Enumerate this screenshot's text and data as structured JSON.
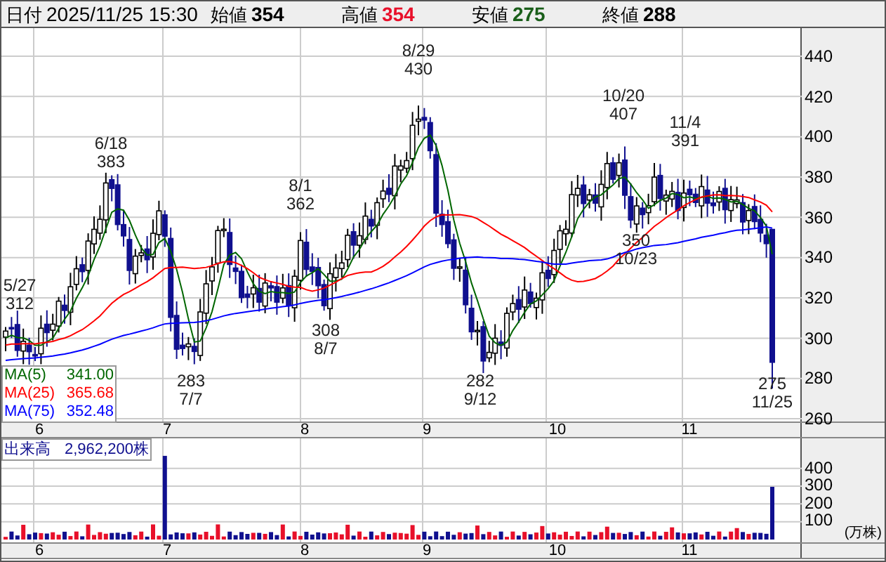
{
  "header": {
    "date_label": "日付",
    "date": "2025/11/25 15:30",
    "fields": [
      {
        "label": "始値",
        "value": "354",
        "kind": "open"
      },
      {
        "label": "高値",
        "value": "354",
        "kind": "high"
      },
      {
        "label": "安値",
        "value": "275",
        "kind": "low"
      },
      {
        "label": "終値",
        "value": "288",
        "kind": "close"
      }
    ]
  },
  "price_chart": {
    "y_axis": [
      "440",
      "420",
      "400",
      "380",
      "360",
      "340",
      "320",
      "300",
      "280",
      "260"
    ],
    "annotations": [
      {
        "lines": [
          "5/27",
          "312"
        ]
      },
      {
        "lines": [
          "6/18",
          "383"
        ]
      },
      {
        "lines": [
          "283",
          "7/7"
        ]
      },
      {
        "lines": [
          "8/1",
          "362"
        ]
      },
      {
        "lines": [
          "308",
          "8/7"
        ]
      },
      {
        "lines": [
          "8/29",
          "430"
        ]
      },
      {
        "lines": [
          "282",
          "9/12"
        ]
      },
      {
        "lines": [
          "10/20",
          "407"
        ]
      },
      {
        "lines": [
          "350",
          "10/23"
        ]
      },
      {
        "lines": [
          "11/4",
          "391"
        ]
      },
      {
        "lines": [
          "275",
          "11/25"
        ]
      }
    ],
    "moving_averages": [
      {
        "name": "MA(5)",
        "value": "341.00",
        "color": "#006600"
      },
      {
        "name": "MA(25)",
        "value": "365.68",
        "color": "#ff0000"
      },
      {
        "name": "MA(75)",
        "value": "352.48",
        "color": "#0000ff"
      }
    ],
    "x_labels": [
      "6",
      "7",
      "8",
      "9",
      "10",
      "11"
    ]
  },
  "volume_chart": {
    "title": "出来高",
    "value": "2,962,200株",
    "y_axis": [
      "400",
      "300",
      "200",
      "100"
    ],
    "unit": "(万株)",
    "x_labels": [
      "6",
      "7",
      "8",
      "9",
      "10",
      "11"
    ]
  }
}
